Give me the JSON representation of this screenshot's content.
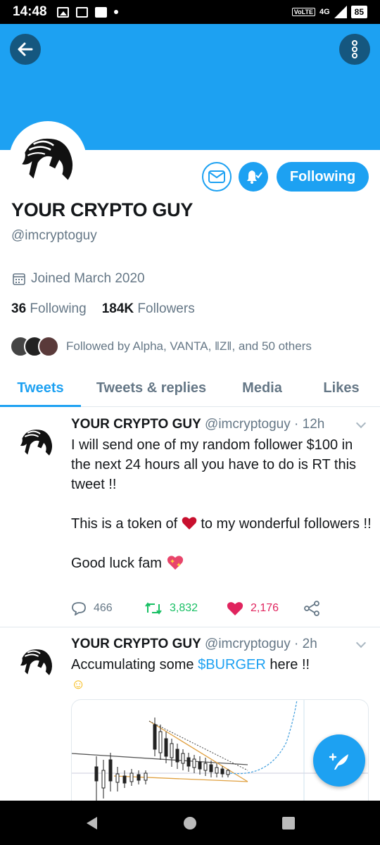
{
  "status_bar": {
    "time": "14:48",
    "volte": "VoLTE",
    "network": "4G",
    "battery": "85"
  },
  "profile": {
    "name": "YOUR CRYPTO GUY",
    "handle": "@imcryptoguy",
    "joined": "Joined March 2020",
    "following_count": "36",
    "following_label": "Following",
    "followers_count": "184K",
    "followers_label": "Followers",
    "followed_by": "Followed by Alpha, VANTA, ‖Z‖, and 50 others",
    "follow_button": "Following"
  },
  "tabs": [
    {
      "label": "Tweets",
      "active": true
    },
    {
      "label": "Tweets & replies",
      "active": false
    },
    {
      "label": "Media",
      "active": false
    },
    {
      "label": "Likes",
      "active": false
    }
  ],
  "tweets": [
    {
      "name": "YOUR CRYPTO GUY",
      "handle_time": "@imcryptoguy · 12h",
      "line1": "I will send one of my random follower $100 in the next 24 hours all you have to do is RT this tweet !!",
      "line2a": "This is a token of",
      "line2b": "to my wonderful followers !!",
      "line3": "Good luck fam",
      "replies": "466",
      "retweets": "3,832",
      "likes": "2,176"
    },
    {
      "name": "YOUR CRYPTO GUY",
      "handle_time": "@imcryptoguy · 2h",
      "text_before": "Accumulating some",
      "cashtag": "$BURGER",
      "text_after": "here !!",
      "emoji": "☺"
    }
  ],
  "colors": {
    "accent": "#1da1f2",
    "retweet": "#17bf63",
    "like": "#e0245e",
    "muted": "#657786"
  }
}
